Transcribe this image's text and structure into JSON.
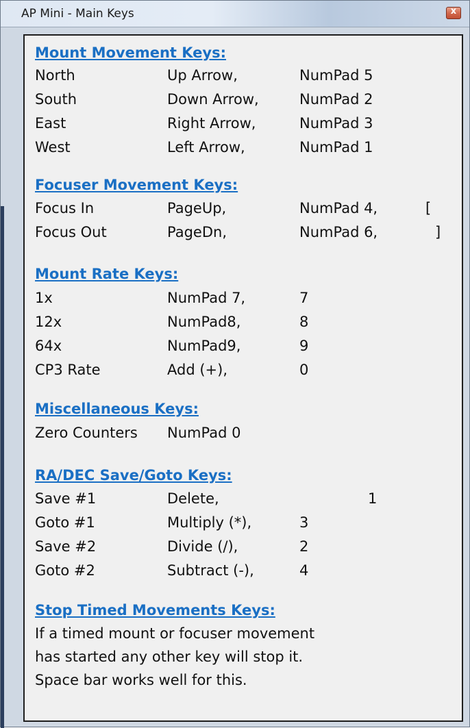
{
  "window": {
    "title": "AP Mini - Main Keys",
    "close_glyph": "x"
  },
  "sections": [
    {
      "heading": "Mount Movement Keys:",
      "rows": [
        [
          "North",
          "Up Arrow,",
          "NumPad 5",
          ""
        ],
        [
          "South",
          "Down Arrow,",
          "NumPad 2",
          ""
        ],
        [
          "East",
          "Right Arrow,",
          "NumPad 3",
          ""
        ],
        [
          "West",
          "Left Arrow,",
          "NumPad 1",
          ""
        ]
      ]
    },
    {
      "heading": "Focuser Movement Keys:",
      "rows": [
        [
          "Focus In",
          "PageUp,",
          "NumPad 4,",
          "["
        ],
        [
          "Focus Out",
          "PageDn,",
          "NumPad 6,",
          "]"
        ]
      ]
    },
    {
      "heading": "Mount Rate Keys:",
      "rows": [
        [
          "1x",
          "NumPad 7,",
          "7",
          ""
        ],
        [
          "12x",
          "NumPad8,",
          "8",
          ""
        ],
        [
          "64x",
          "NumPad9,",
          "9",
          ""
        ],
        [
          "CP3 Rate",
          "Add (+),",
          "0",
          ""
        ]
      ]
    },
    {
      "heading": "Miscellaneous Keys:",
      "rows": [
        [
          "Zero Counters",
          "NumPad 0",
          "",
          ""
        ]
      ]
    },
    {
      "heading": "RA/DEC Save/Goto Keys:",
      "rows": [
        [
          "Save #1",
          "Delete,",
          "",
          "1"
        ],
        [
          "Goto #1",
          "Multiply (*),",
          "3",
          ""
        ],
        [
          "Save #2",
          "Divide (/),",
          "2",
          ""
        ],
        [
          "Goto #2",
          "Subtract (-),",
          "4",
          ""
        ]
      ]
    },
    {
      "heading": "Stop Timed Movements Keys:",
      "lines": [
        "If a timed mount or focuser movement",
        "has started any other key will stop it.",
        "Space bar works well for this."
      ]
    }
  ],
  "colors": {
    "heading": "#1a6fc4",
    "text": "#111111",
    "panel_bg": "#f0f0f0",
    "close_button": "#c24f33"
  },
  "icons": {
    "close": "close-icon"
  }
}
